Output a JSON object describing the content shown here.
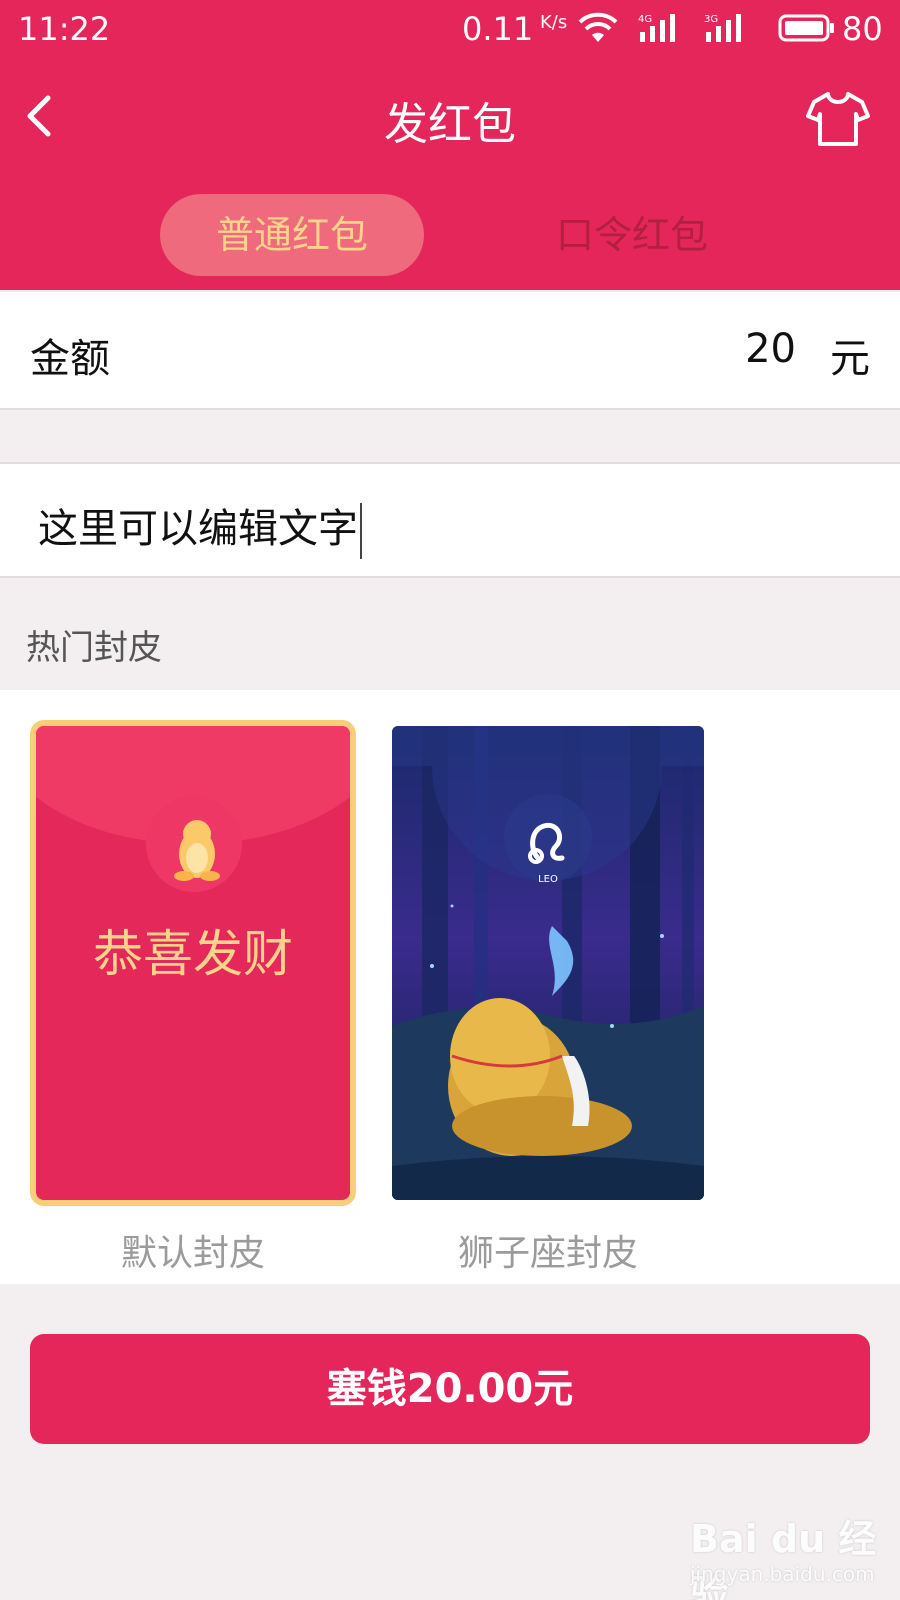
{
  "status_bar": {
    "time": "11:22",
    "net_speed": "0.11",
    "net_speed_unit": "K/s",
    "signal_1_label": "4G",
    "signal_2_label": "3G",
    "battery": "80"
  },
  "header": {
    "title": "发红包",
    "back_icon": "chevron-left-icon",
    "skin_icon": "tshirt-icon",
    "tabs": [
      {
        "label": "普通红包",
        "active": true
      },
      {
        "label": "口令红包",
        "active": false
      }
    ]
  },
  "form": {
    "amount_label": "金额",
    "amount_value": "20",
    "amount_unit": "元",
    "message_text": "这里可以编辑文字"
  },
  "skins": {
    "section_title": "热门封皮",
    "items": [
      {
        "caption": "默认封皮",
        "cover_text": "恭喜发财",
        "selected": true
      },
      {
        "caption": "狮子座封皮",
        "cover_text": "LEO",
        "selected": false
      }
    ]
  },
  "send_button": {
    "label": "塞钱20.00元"
  },
  "watermark": {
    "logo": "Bai du 经验",
    "url": "jingyan.baidu.com"
  },
  "colors": {
    "accent": "#e4265a",
    "gold": "#fbd38a",
    "background": "#f3eff1"
  }
}
